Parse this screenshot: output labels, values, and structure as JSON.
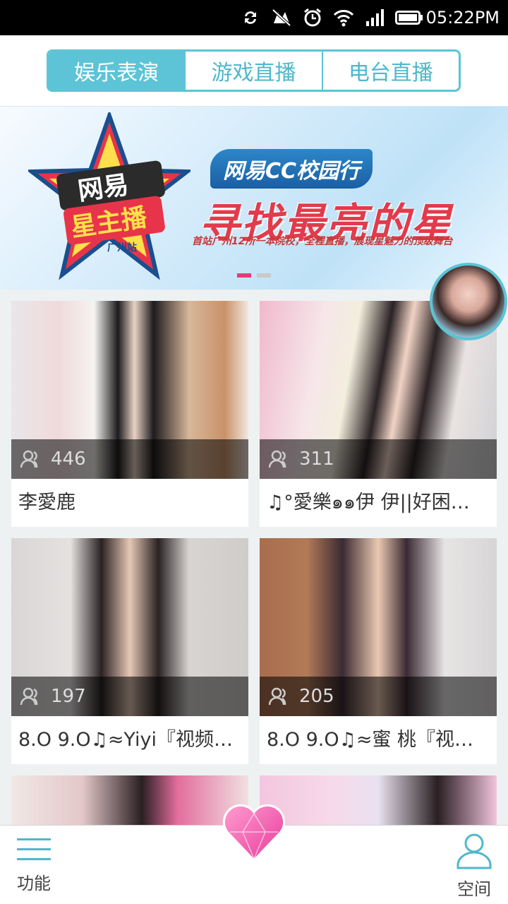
{
  "status_bar": {
    "time": "05:22PM",
    "icons": [
      "sync-icon",
      "mute-icon",
      "alarm-icon",
      "wifi-icon",
      "signal-icon",
      "battery-icon"
    ]
  },
  "tabs": [
    {
      "label": "娱乐表演",
      "active": true
    },
    {
      "label": "游戏直播",
      "active": false
    },
    {
      "label": "电台直播",
      "active": false
    }
  ],
  "banner": {
    "logo_line1": "网易",
    "logo_line2": "星主播",
    "logo_line3": "广州站",
    "badge": "网易CC校园行",
    "headline": "寻找最亮的星",
    "subline": "首站广州12所一本院校，全程直播，展现星魅力的顶级舞台",
    "page_indicator": {
      "count": 2,
      "active": 1
    }
  },
  "cards": [
    {
      "viewers": "446",
      "title": "李愛鹿"
    },
    {
      "viewers": "311",
      "title": "♫°愛樂๑๑伊  伊||好困…"
    },
    {
      "viewers": "197",
      "title": "8.O 9.O♫≈Yiyi『视频…"
    },
    {
      "viewers": "205",
      "title": "8.O 9.O♫≈蜜  桃『视…"
    }
  ],
  "bottom_nav": {
    "left_label": "功能",
    "right_label": "空间"
  },
  "colors": {
    "accent": "#5cc4d6",
    "banner_red": "#e23b4c",
    "heart_pink": "#f26bb5"
  }
}
